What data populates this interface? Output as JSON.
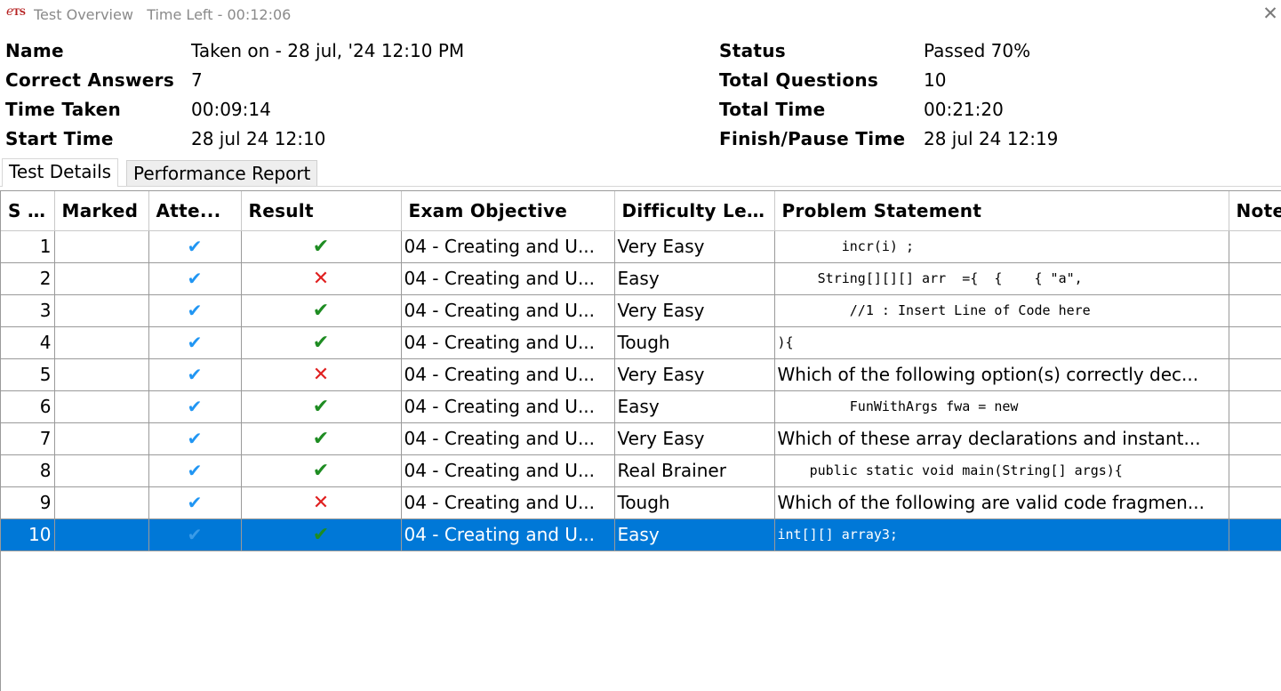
{
  "window": {
    "logo_text": "ETS",
    "title": "Test Overview",
    "time_left": "Time Left - 00:12:06"
  },
  "summary": {
    "name_label": "Name",
    "name_value": "Taken on - 28 jul, '24 12:10 PM",
    "correct_label": "Correct Answers",
    "correct_value": "7",
    "time_taken_label": "Time Taken",
    "time_taken_value": "00:09:14",
    "start_label": "Start Time",
    "start_value": "28 jul 24 12:10",
    "status_label": "Status",
    "status_value": "Passed 70%",
    "total_q_label": "Total Questions",
    "total_q_value": "10",
    "total_time_label": "Total Time",
    "total_time_value": "00:21:20",
    "finish_label": "Finish/Pause Time",
    "finish_value": "28 jul 24 12:19"
  },
  "tabs": [
    {
      "label": "Test Details",
      "active": true
    },
    {
      "label": "Performance Report",
      "active": false
    }
  ],
  "table": {
    "headers": [
      "S ...",
      "Marked",
      "Atte...",
      "Result",
      "Exam Objective",
      "Difficulty Le...",
      "Problem Statement",
      "Note"
    ],
    "rows": [
      {
        "sno": "1",
        "marked": "",
        "attempted": "✔",
        "result": "correct",
        "objective": "04 - Creating and U...",
        "difficulty": "Very Easy",
        "problem": "        incr(i) ;",
        "problem_code": true
      },
      {
        "sno": "2",
        "marked": "",
        "attempted": "✔",
        "result": "wrong",
        "objective": "04 - Creating and U...",
        "difficulty": "Easy",
        "problem": "     String[][][] arr  ={  {    { \"a\",",
        "problem_code": true
      },
      {
        "sno": "3",
        "marked": "",
        "attempted": "✔",
        "result": "correct",
        "objective": "04 - Creating and U...",
        "difficulty": "Very Easy",
        "problem": "         //1 : Insert Line of Code here",
        "problem_code": true
      },
      {
        "sno": "4",
        "marked": "",
        "attempted": "✔",
        "result": "correct",
        "objective": "04 - Creating and U...",
        "difficulty": "Tough",
        "problem": "){",
        "problem_code": true
      },
      {
        "sno": "5",
        "marked": "",
        "attempted": "✔",
        "result": "wrong",
        "objective": "04 - Creating and U...",
        "difficulty": "Very Easy",
        "problem": "Which of the following option(s) correctly dec...",
        "problem_code": false
      },
      {
        "sno": "6",
        "marked": "",
        "attempted": "✔",
        "result": "correct",
        "objective": "04 - Creating and U...",
        "difficulty": "Easy",
        "problem": "         FunWithArgs fwa = new",
        "problem_code": true
      },
      {
        "sno": "7",
        "marked": "",
        "attempted": "✔",
        "result": "correct",
        "objective": "04 - Creating and U...",
        "difficulty": "Very Easy",
        "problem": "Which of these array declarations and instant...",
        "problem_code": false
      },
      {
        "sno": "8",
        "marked": "",
        "attempted": "✔",
        "result": "correct",
        "objective": "04 - Creating and U...",
        "difficulty": "Real Brainer",
        "problem": "    public static void main(String[] args){",
        "problem_code": true
      },
      {
        "sno": "9",
        "marked": "",
        "attempted": "✔",
        "result": "wrong",
        "objective": "04 - Creating and U...",
        "difficulty": "Tough",
        "problem": "Which of the following are valid code fragmen...",
        "problem_code": false
      },
      {
        "sno": "10",
        "marked": "",
        "attempted": "✔",
        "result": "correct",
        "objective": "04 - Creating and U...",
        "difficulty": "Easy",
        "problem": "int[][] array3;",
        "problem_code": true,
        "selected": true
      }
    ]
  },
  "icons": {
    "attempted": "check-icon",
    "correct": "check-icon",
    "wrong": "cross-icon",
    "close": "close-icon"
  },
  "colors": {
    "selection": "#0078d7",
    "correct": "#1e8c22",
    "wrong": "#e02020",
    "attempted": "#2196f3",
    "logo": "#b52020"
  }
}
